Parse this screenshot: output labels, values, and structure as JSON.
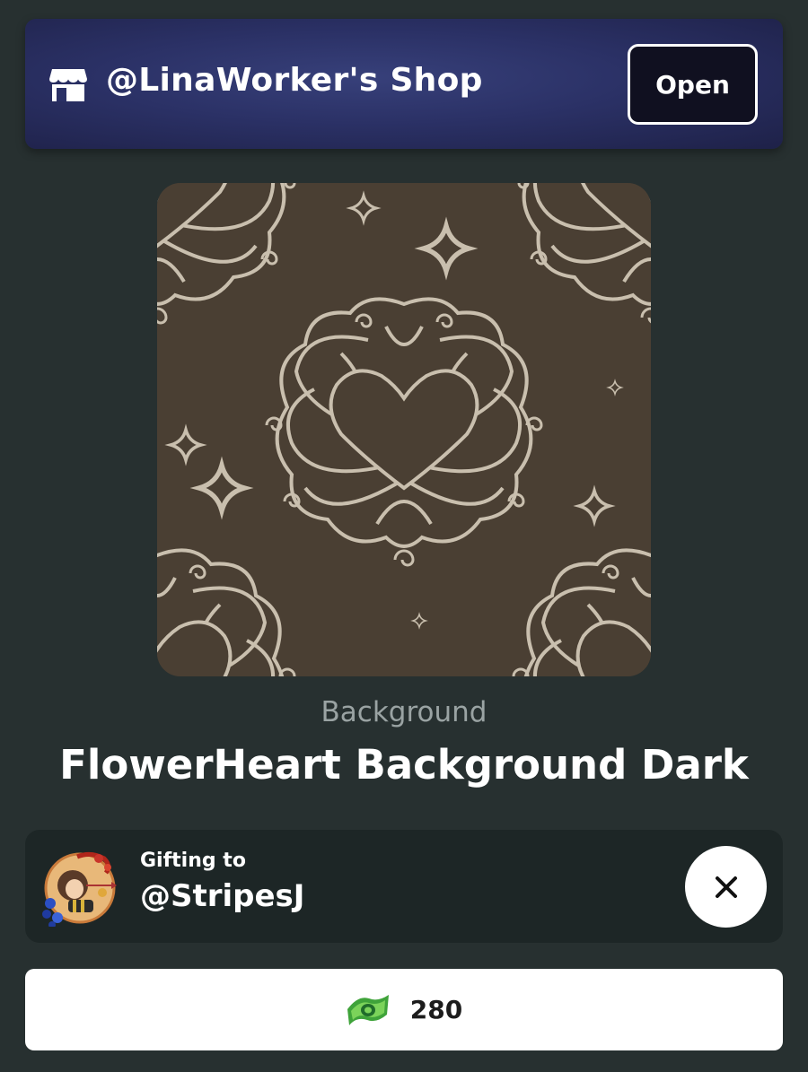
{
  "shop": {
    "title": "@LinaWorker's Shop",
    "open_label": "Open",
    "icon": "store-icon"
  },
  "item": {
    "category": "Background",
    "name": "FlowerHeart Background Dark",
    "preview_colors": {
      "background": "#4a3f33",
      "line": "#c9bfae"
    }
  },
  "gift": {
    "label": "Gifting to",
    "recipient": "@StripesJ",
    "close_icon": "close-icon"
  },
  "purchase": {
    "price": "280",
    "currency_icon": "cash-icon"
  },
  "colors": {
    "page_background": "#273030",
    "banner_accent": "#2b3166",
    "card_background": "#1d2626"
  }
}
